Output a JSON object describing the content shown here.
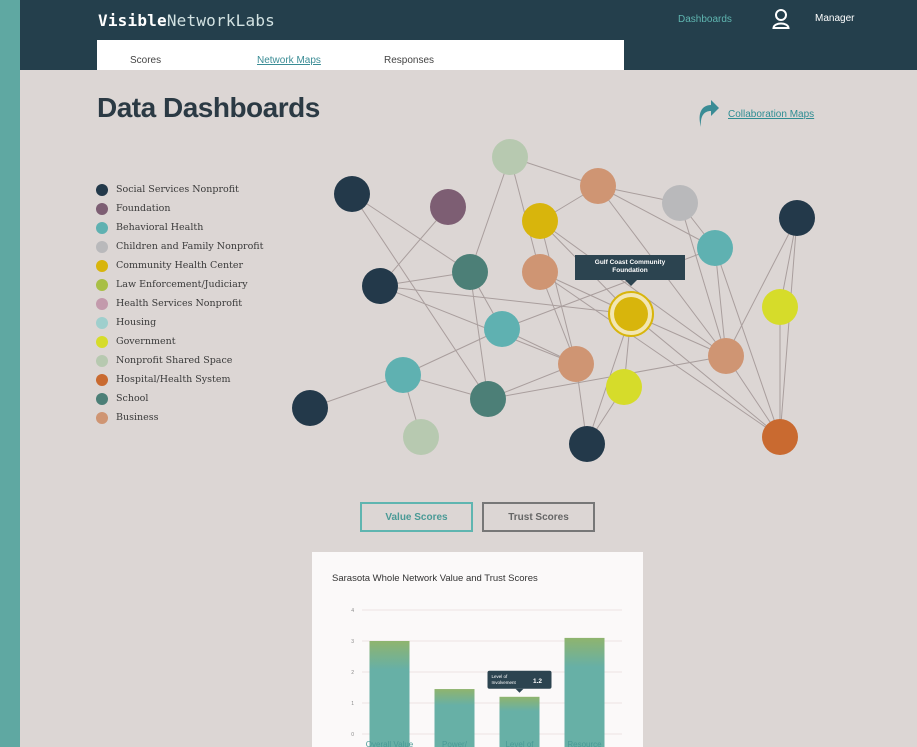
{
  "app": {
    "logo_bold": "Visible",
    "logo_rest": "NetworkLabs",
    "nav_dashboards": "Dashboards",
    "user_label": "Manager"
  },
  "tabs": [
    {
      "label": "Scores",
      "active": false
    },
    {
      "label": "Network Maps",
      "active": true
    },
    {
      "label": "Responses",
      "active": false
    }
  ],
  "page": {
    "title": "Data Dashboards",
    "collab_link": "Collaboration Maps"
  },
  "legend": [
    {
      "label": "Social Services Nonprofit",
      "color": "#23394a"
    },
    {
      "label": "Foundation",
      "color": "#7d5e73"
    },
    {
      "label": "Behavioral Health",
      "color": "#5fb1b1"
    },
    {
      "label": "Children and Family Nonprofit",
      "color": "#b9b9bb"
    },
    {
      "label": "Community Health Center",
      "color": "#d8b50c"
    },
    {
      "label": "Law Enforcement/Judiciary",
      "color": "#a8bf45"
    },
    {
      "label": "Health Services Nonprofit",
      "color": "#c39aac"
    },
    {
      "label": "Housing",
      "color": "#9fcfcd"
    },
    {
      "label": "Government",
      "color": "#d6dc2a"
    },
    {
      "label": "Nonprofit Shared Space",
      "color": "#b7c9b0"
    },
    {
      "label": "Hospital/Health System",
      "color": "#c96a30"
    },
    {
      "label": "School",
      "color": "#4c7f77"
    },
    {
      "label": "Business",
      "color": "#cf9573"
    }
  ],
  "network": {
    "tooltip_line1": "Gulf Coast Community",
    "tooltip_line2": "Foundation",
    "selected_node_color": "#d8b50c",
    "edge_color": "#a99e9d"
  },
  "buttons": {
    "value_scores": "Value Scores",
    "trust_scores": "Trust Scores"
  },
  "chart_data": {
    "type": "bar",
    "title": "Sarasota Whole Network Value and Trust Scores",
    "ylim": [
      0,
      4
    ],
    "yticks": [
      "0",
      "1",
      "2",
      "3",
      "4"
    ],
    "categories": [
      "Overall Value",
      "Power/",
      "Level of",
      "Resource"
    ],
    "values": [
      3.0,
      1.45,
      1.2,
      3.1
    ],
    "bar_color": "#67b0a6",
    "bar_top_color": "#8fb46e",
    "tooltip": {
      "label_line1": "Level of",
      "label_line2": "Involvement",
      "value": "1.2"
    }
  }
}
